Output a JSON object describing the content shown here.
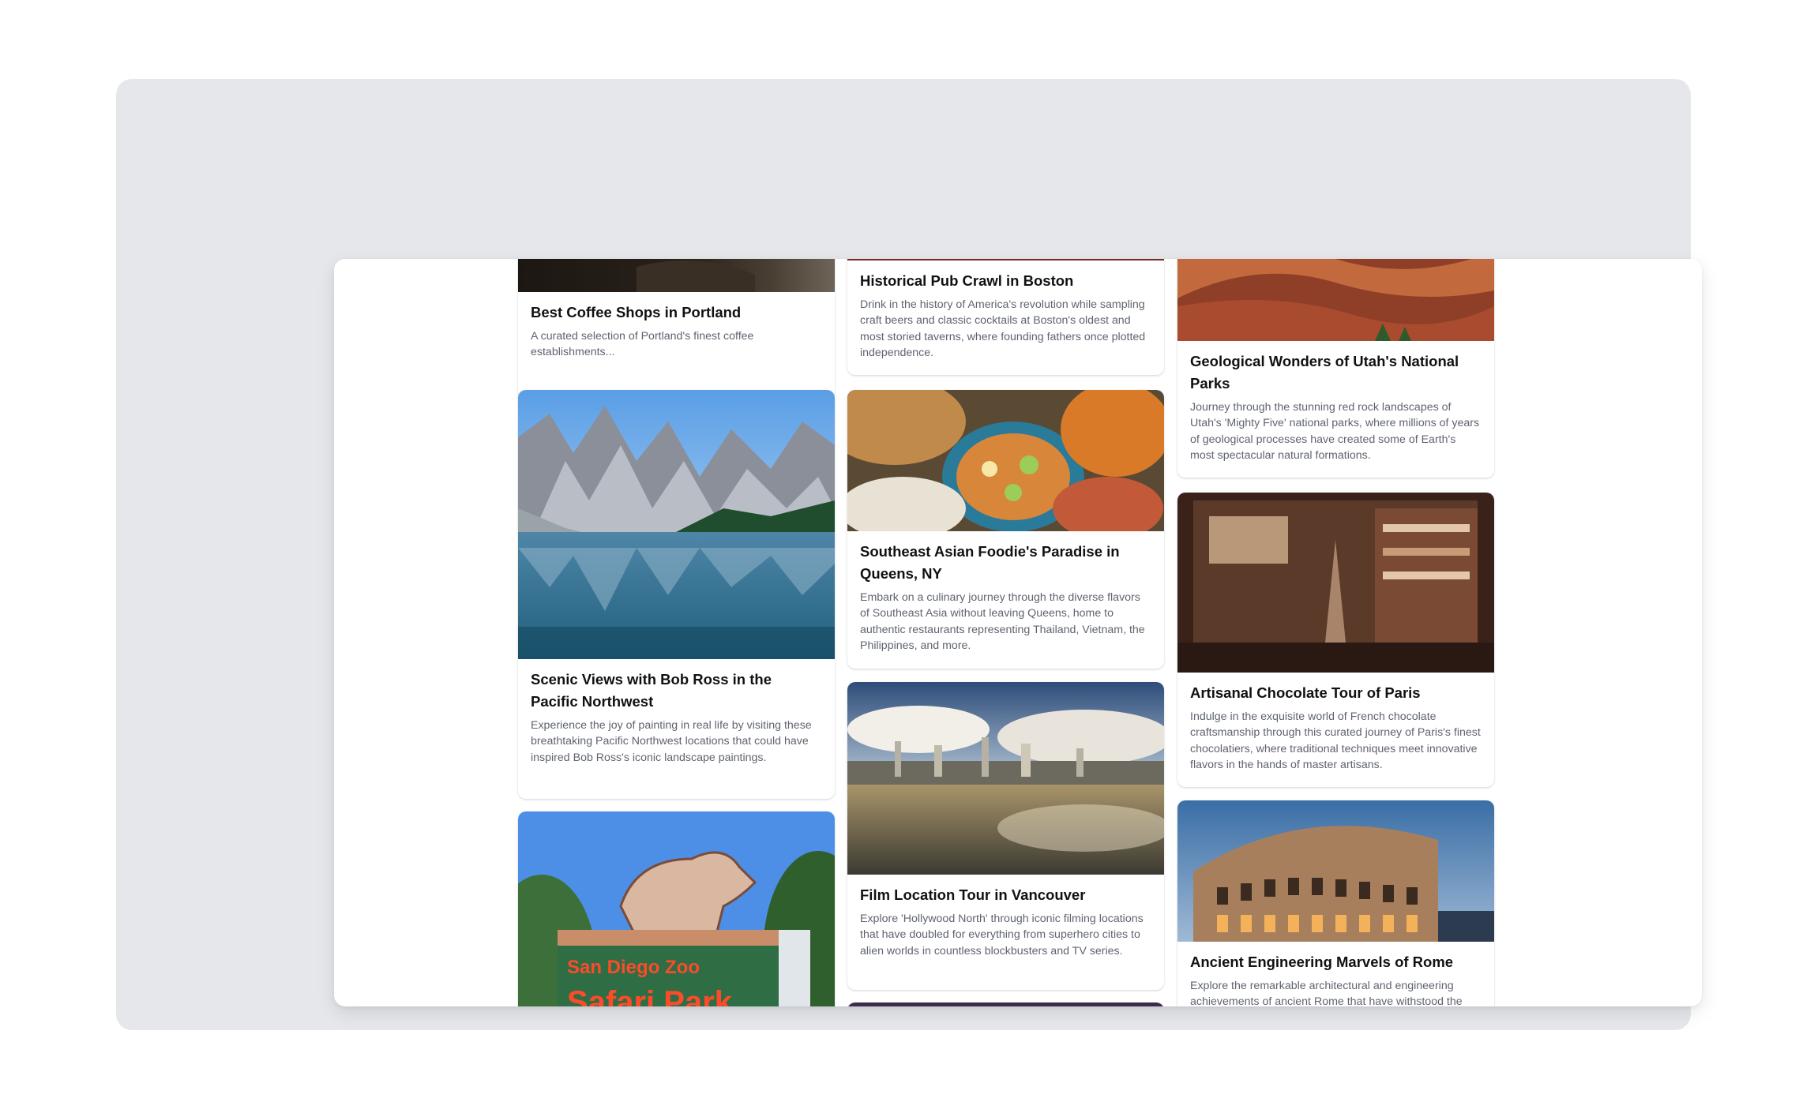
{
  "cards": [
    {
      "image_icon": "coffee-image",
      "title": "Best Coffee Shops in Portland",
      "description": "A curated selection of Portland's finest coffee establishments..."
    },
    {
      "image_icon": "mountain-lake-image",
      "title": "Scenic Views with Bob Ross in the Pacific Northwest",
      "description": "Experience the joy of painting in real life by visiting these breathtaking Pacific Northwest locations that could have inspired Bob Ross's iconic landscape paintings."
    },
    {
      "image_icon": "safari-park-image",
      "sign_text": "San Diego Zoo Safari Park"
    },
    {
      "image_icon": "pub-image",
      "title": "Historical Pub Crawl in Boston",
      "description": "Drink in the history of America's revolution while sampling craft beers and classic cocktails at Boston's oldest and most storied taverns, where founding fathers once plotted independence."
    },
    {
      "image_icon": "asian-food-image",
      "title": "Southeast Asian Foodie's Paradise in Queens, NY",
      "description": "Embark on a culinary journey through the diverse flavors of Southeast Asia without leaving Queens, home to authentic restaurants representing Thailand, Vietnam, the Philippines, and more."
    },
    {
      "image_icon": "vancouver-skyline-image",
      "title": "Film Location Tour in Vancouver",
      "description": "Explore 'Hollywood North' through iconic filming locations that have doubled for everything from superhero cities to alien worlds in countless blockbusters and TV series."
    },
    {
      "image_icon": "red-rock-image",
      "title": "Geological Wonders of Utah's National Parks",
      "description": "Journey through the stunning red rock landscapes of Utah's 'Mighty Five' national parks, where millions of years of geological processes have created some of Earth's most spectacular natural formations."
    },
    {
      "image_icon": "chocolate-shop-image",
      "title": "Artisanal Chocolate Tour of Paris",
      "description": "Indulge in the exquisite world of French chocolate craftsmanship through this curated journey of Paris's finest chocolatiers, where traditional techniques meet innovative flavors in the hands of master artisans."
    },
    {
      "image_icon": "colosseum-image",
      "title": "Ancient Engineering Marvels of Rome",
      "description": "Explore the remarkable architectural and engineering achievements of ancient Rome that have withstood the test of time."
    }
  ]
}
